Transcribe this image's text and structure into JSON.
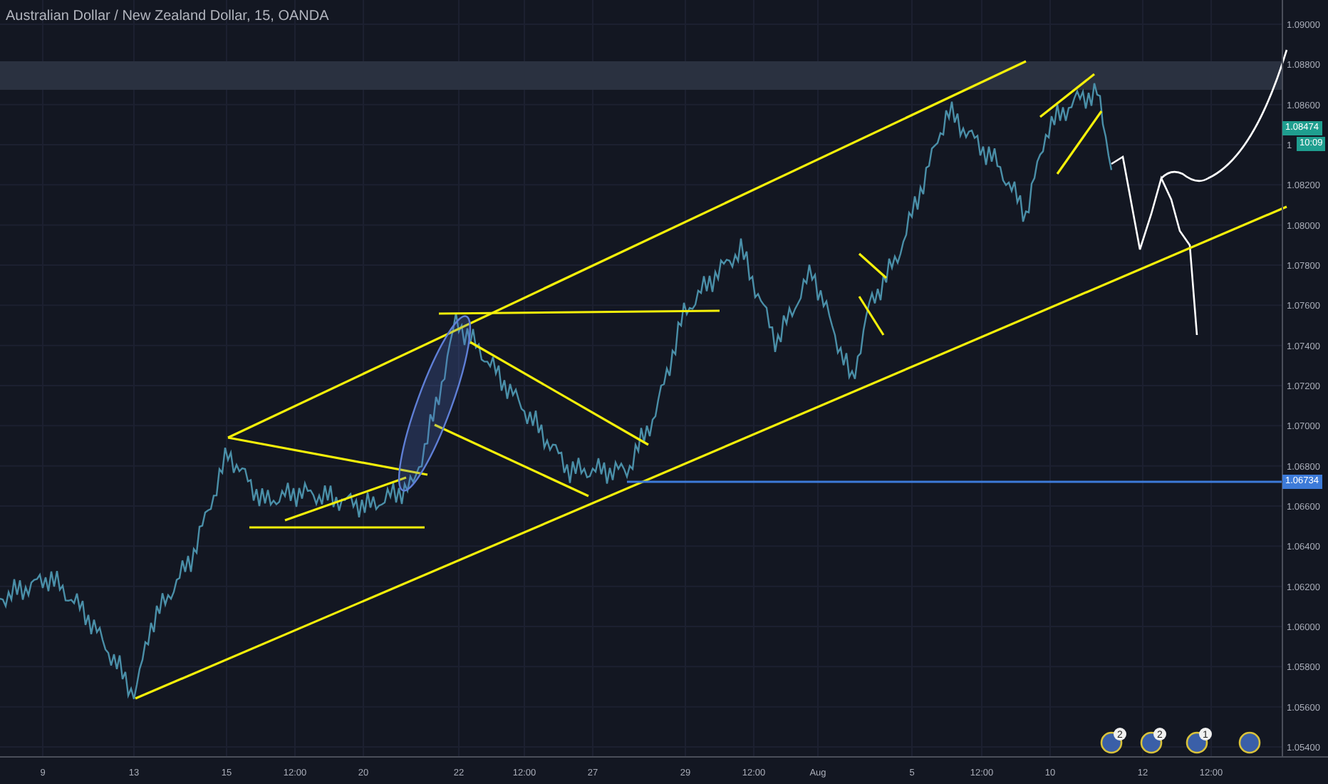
{
  "title": "Australian Dollar / New Zealand Dollar, 15, OANDA",
  "price_axis": [
    "1.09000",
    "1.08800",
    "1.08600",
    "1",
    "1.08200",
    "1.08000",
    "1.07800",
    "1.07600",
    "1.07400",
    "1.07200",
    "1.07000",
    "1.06800",
    "1.06600",
    "1.06400",
    "1.06200",
    "1.06000",
    "1.05800",
    "1.05600",
    "1.05400"
  ],
  "current_price": {
    "label": "1.08474",
    "countdown": "10:09"
  },
  "level_line": {
    "label": "1.06734"
  },
  "time_axis": [
    "9",
    "13",
    "15",
    "12:00",
    "20",
    "22",
    "12:00",
    "27",
    "29",
    "12:00",
    "Aug",
    "5",
    "12:00",
    "10",
    "12",
    "12:00"
  ],
  "events": [
    {
      "badged": true,
      "badge": "2"
    },
    {
      "badged": true,
      "badge": "2"
    },
    {
      "badged": true,
      "badge": "1"
    },
    {
      "badged": false
    }
  ]
}
